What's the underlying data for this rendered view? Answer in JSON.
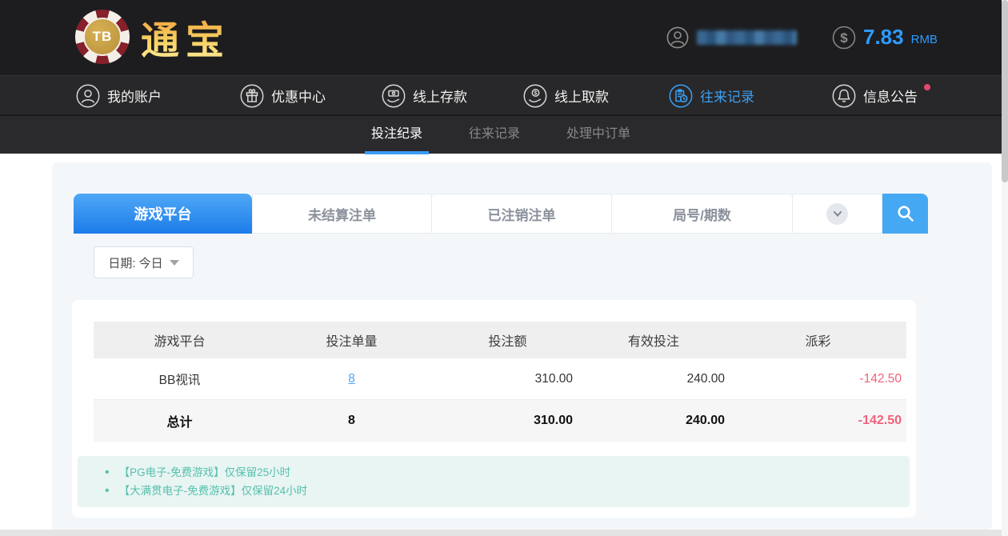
{
  "header": {
    "logo": {
      "badge": "TB",
      "text": "通宝"
    },
    "balance": {
      "amount": "7.83",
      "currency": "RMB"
    }
  },
  "nav": {
    "items": [
      {
        "label": "我的账户",
        "icon": "user-icon"
      },
      {
        "label": "优惠中心",
        "icon": "gift-icon"
      },
      {
        "label": "线上存款",
        "icon": "deposit-icon"
      },
      {
        "label": "线上取款",
        "icon": "withdraw-icon"
      },
      {
        "label": "往来记录",
        "icon": "records-icon",
        "active": true
      },
      {
        "label": "信息公告",
        "icon": "bell-icon",
        "notification_dot": true
      }
    ]
  },
  "subnav": {
    "items": [
      {
        "label": "投注纪录",
        "active": true
      },
      {
        "label": "往来记录"
      },
      {
        "label": "处理中订单"
      }
    ]
  },
  "toolbar": {
    "tabs": [
      {
        "label": "游戏平台",
        "active": true
      },
      {
        "label": "未结算注单"
      },
      {
        "label": "已注销注单"
      },
      {
        "label": "局号/期数"
      }
    ],
    "date_filter": "日期: 今日"
  },
  "table": {
    "headers": [
      "游戏平台",
      "投注单量",
      "投注额",
      "有效投注",
      "派彩"
    ],
    "rows": [
      {
        "platform": "BB视讯",
        "bet_count": "8",
        "bet_amount": "310.00",
        "valid_bet": "240.00",
        "payout": "-142.50"
      }
    ],
    "total": {
      "label": "总计",
      "bet_count": "8",
      "bet_amount": "310.00",
      "valid_bet": "240.00",
      "payout": "-142.50"
    }
  },
  "notes": [
    "【PG电子-免费游戏】仅保留25小时",
    "【大满贯电子-免费游戏】仅保留24小时"
  ],
  "colors": {
    "accent_blue": "#3d9ff0",
    "tab_gradient_top": "#4fa8f6",
    "tab_gradient_bottom": "#1c7ce9",
    "negative_red": "#f0627a",
    "note_teal": "#56bfae",
    "header_dark": "#1d1d1f"
  }
}
